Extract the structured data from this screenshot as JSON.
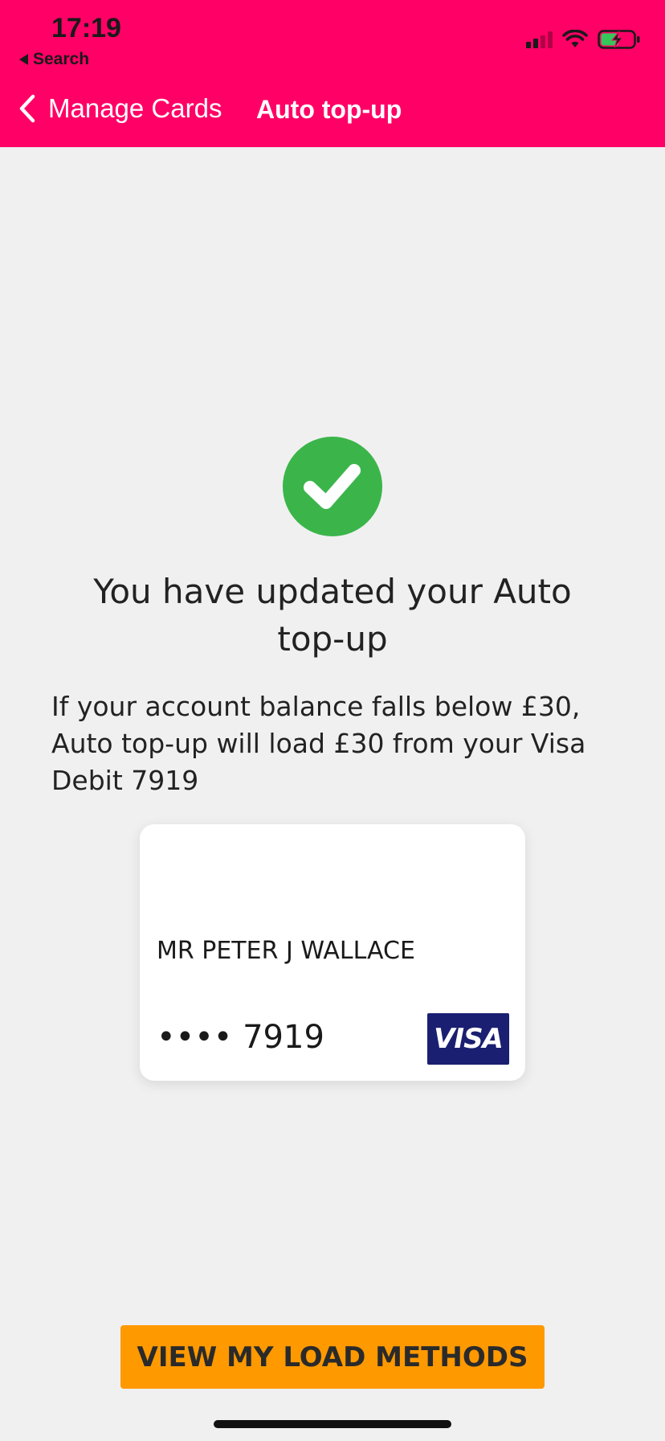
{
  "status_bar": {
    "time": "17:19",
    "back_app_label": "Search"
  },
  "nav": {
    "back_label": "Manage Cards",
    "title": "Auto top-up"
  },
  "main": {
    "heading": "You have updated your Auto top-up",
    "description": "If your account balance falls below £30, Auto top-up will load £30 from your Visa Debit 7919"
  },
  "card": {
    "holder_name": "MR PETER J WALLACE",
    "masked_number": "•••• 7919",
    "brand": "VISA"
  },
  "actions": {
    "view_load_methods_label": "VIEW MY LOAD METHODS"
  },
  "colors": {
    "header": "#ff0066",
    "success": "#3bb54a",
    "cta": "#ff9900",
    "visa_blue": "#1a1f71",
    "background": "#f0f0f1"
  },
  "icons": {
    "success": "checkmark-icon",
    "back": "chevron-left-icon",
    "signal": "cellular-signal-icon",
    "wifi": "wifi-icon",
    "battery": "battery-charging-icon"
  }
}
